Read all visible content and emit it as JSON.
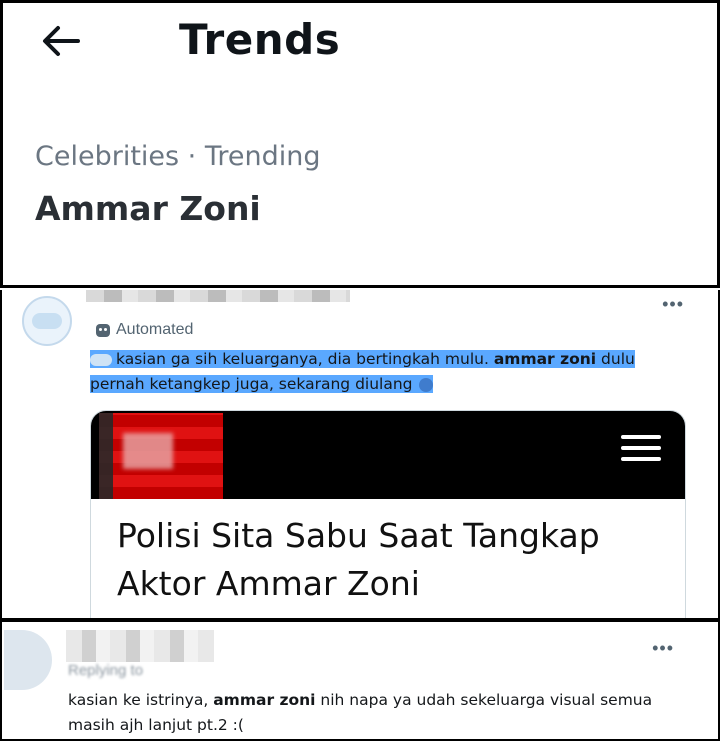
{
  "header": {
    "title": "Trends",
    "category": "Celebrities · Trending",
    "trend": "Ammar Zoni"
  },
  "tweet1": {
    "label": "Automated",
    "text_part1": "kasian ga sih keluarganya, dia bertingkah mulu. ",
    "text_bold": "ammar zoni",
    "text_part2": " dulu pernah ketangkep juga, sekarang diulang",
    "more_label": "•••",
    "card": {
      "title": "Polisi Sita Sabu Saat Tangkap Aktor Ammar Zoni"
    }
  },
  "tweet2": {
    "replying_prefix": "Replying to",
    "replying_handle": "",
    "text_part1": "kasian ke istrinya, ",
    "text_bold": "ammar zoni",
    "text_part2": " nih napa ya udah sekeluarga visual semua masih ajh lanjut pt.2 :(",
    "more_label": "•••"
  },
  "colors": {
    "highlight": "#5aa8ff",
    "muted": "#536471",
    "link": "#1d9bf0"
  }
}
